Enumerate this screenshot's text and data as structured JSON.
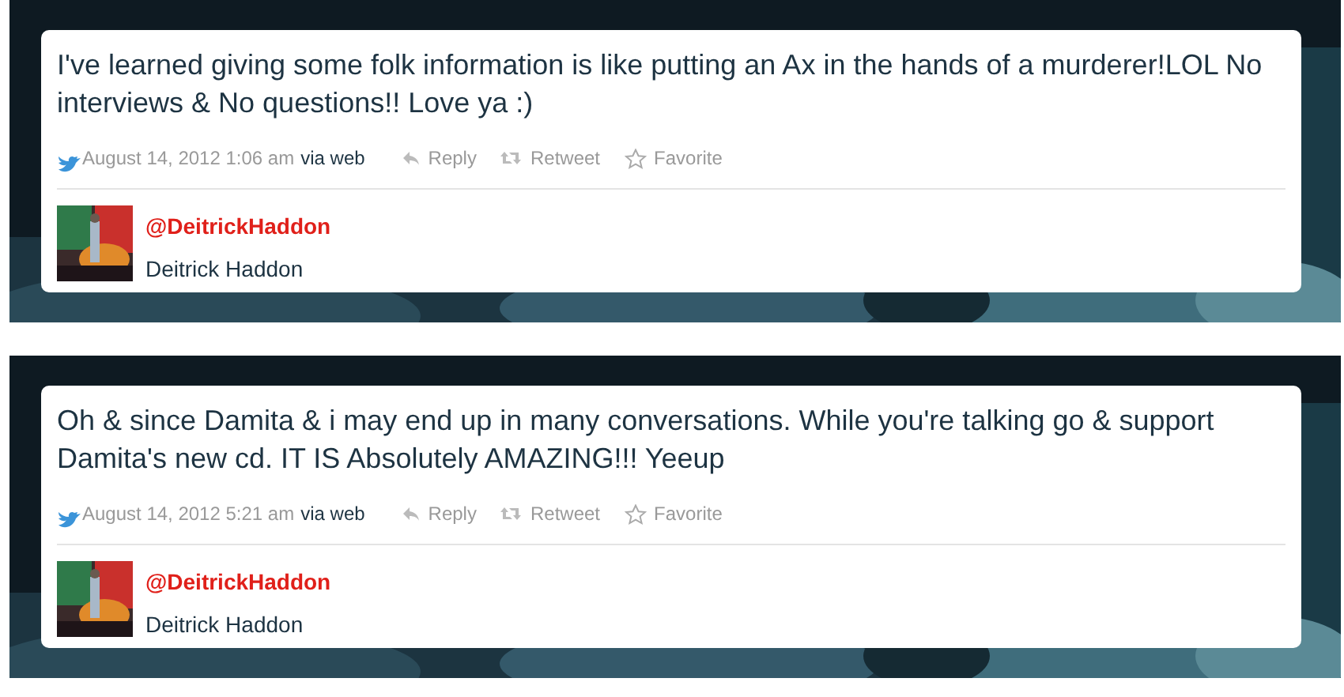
{
  "tweets": [
    {
      "text": "I've learned giving some folk information is like putting an Ax in the hands of a murderer!LOL No interviews & No questions!! Love ya :)",
      "timestamp": "August 14, 2012 1:06 am",
      "via": "via web",
      "actions": [
        "Reply",
        "Retweet",
        "Favorite"
      ],
      "handle": "@DeitrickHaddon",
      "name": "Deitrick Haddon"
    },
    {
      "text": "Oh & since Damita & i may end up in many conversations. While you're talking go & support Damita's new cd. IT IS Absolutely AMAZING!!! Yeeup",
      "timestamp": "August 14, 2012 5:21 am",
      "via": "via web",
      "actions": [
        "Reply",
        "Retweet",
        "Favorite"
      ],
      "handle": "@DeitrickHaddon",
      "name": "Deitrick Haddon"
    }
  ]
}
